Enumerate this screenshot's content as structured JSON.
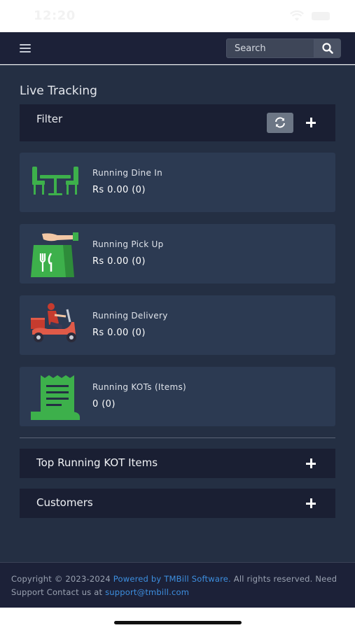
{
  "status_bar": {
    "time": "12:20"
  },
  "navbar": {
    "menu_icon": "hamburger-icon",
    "search_placeholder": "Search",
    "search_icon": "search-icon"
  },
  "page": {
    "title": "Live Tracking"
  },
  "filter": {
    "label": "Filter",
    "refresh_icon": "refresh-icon",
    "expand_icon": "plus-icon"
  },
  "stats": [
    {
      "label": "Running Dine In",
      "value": "Rs 0.00 (0)",
      "icon": "dine-in-table-icon"
    },
    {
      "label": "Running Pick Up",
      "value": "Rs 0.00 (0)",
      "icon": "pickup-bag-icon"
    },
    {
      "label": "Running Delivery",
      "value": "Rs 0.00 (0)",
      "icon": "delivery-scooter-icon"
    },
    {
      "label": "Running KOTs (Items)",
      "value": "0 (0)",
      "icon": "kot-receipt-icon"
    }
  ],
  "panels": [
    {
      "title": "Top Running KOT Items",
      "expand_icon": "plus-icon"
    },
    {
      "title": "Customers",
      "expand_icon": "plus-icon"
    }
  ],
  "footer": {
    "copyright": "Copyright © 2023-2024 ",
    "powered_by": "Powered by TMBill Software.",
    "rights": " All rights reserved. Need Support Contact us at ",
    "email": "support@tmbill.com"
  },
  "colors": {
    "navbar_bg": "#1c2138",
    "main_bg": "#242f43",
    "card_bg": "#2c3a52",
    "panel_bg": "#1a1f33",
    "icon_green": "#3db04b",
    "link_blue": "#3d8fe0"
  }
}
